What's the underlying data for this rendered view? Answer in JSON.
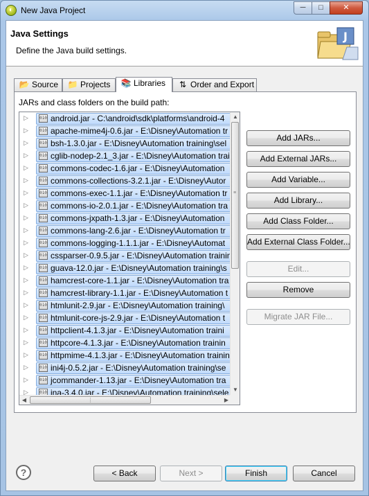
{
  "window": {
    "title": "New Java Project",
    "min_glyph": "─",
    "max_glyph": "□",
    "close_glyph": "✕"
  },
  "banner": {
    "title": "Java Settings",
    "description": "Define the Java build settings."
  },
  "tabs": [
    {
      "label": "Source",
      "icon": "source-folder-icon",
      "active": false
    },
    {
      "label": "Projects",
      "icon": "projects-icon",
      "active": false
    },
    {
      "label": "Libraries",
      "icon": "libraries-icon",
      "active": true
    },
    {
      "label": "Order and Export",
      "icon": "order-export-icon",
      "active": false
    }
  ],
  "libraries": {
    "label": "JARs and class folders on the build path:",
    "jar_icon_text": "010",
    "items": [
      "android.jar - C:\\android\\sdk\\platforms\\android-4",
      "apache-mime4j-0.6.jar - E:\\Disney\\Automation tr",
      "bsh-1.3.0.jar - E:\\Disney\\Automation training\\sel",
      "cglib-nodep-2.1_3.jar - E:\\Disney\\Automation trai",
      "commons-codec-1.6.jar - E:\\Disney\\Automation",
      "commons-collections-3.2.1.jar - E:\\Disney\\Autor",
      "commons-exec-1.1.jar - E:\\Disney\\Automation tr",
      "commons-io-2.0.1.jar - E:\\Disney\\Automation tra",
      "commons-jxpath-1.3.jar - E:\\Disney\\Automation",
      "commons-lang-2.6.jar - E:\\Disney\\Automation tr",
      "commons-logging-1.1.1.jar - E:\\Disney\\Automat",
      "cssparser-0.9.5.jar - E:\\Disney\\Automation trainin",
      "guava-12.0.jar - E:\\Disney\\Automation training\\s",
      "hamcrest-core-1.1.jar - E:\\Disney\\Automation tra",
      "hamcrest-library-1.1.jar - E:\\Disney\\Automation t",
      "htmlunit-2.9.jar - E:\\Disney\\Automation training\\",
      "htmlunit-core-js-2.9.jar - E:\\Disney\\Automation t",
      "httpclient-4.1.3.jar - E:\\Disney\\Automation traini",
      "httpcore-4.1.3.jar - E:\\Disney\\Automation trainin",
      "httpmime-4.1.3.jar - E:\\Disney\\Automation trainin",
      "ini4j-0.5.2.jar - E:\\Disney\\Automation training\\se",
      "jcommander-1.13.jar - E:\\Disney\\Automation tra",
      "jna-3.4.0.jar - E:\\Disney\\Automation training\\sele"
    ]
  },
  "side_buttons": {
    "add_jars": "Add JARs...",
    "add_external_jars": "Add External JARs...",
    "add_variable": "Add Variable...",
    "add_library": "Add Library...",
    "add_class_folder": "Add Class Folder...",
    "add_external_class_folder": "Add External Class Folder...",
    "edit": "Edit...",
    "remove": "Remove",
    "migrate_jar": "Migrate JAR File..."
  },
  "footer": {
    "help_glyph": "?",
    "back": "< Back",
    "next": "Next >",
    "finish": "Finish",
    "cancel": "Cancel"
  }
}
